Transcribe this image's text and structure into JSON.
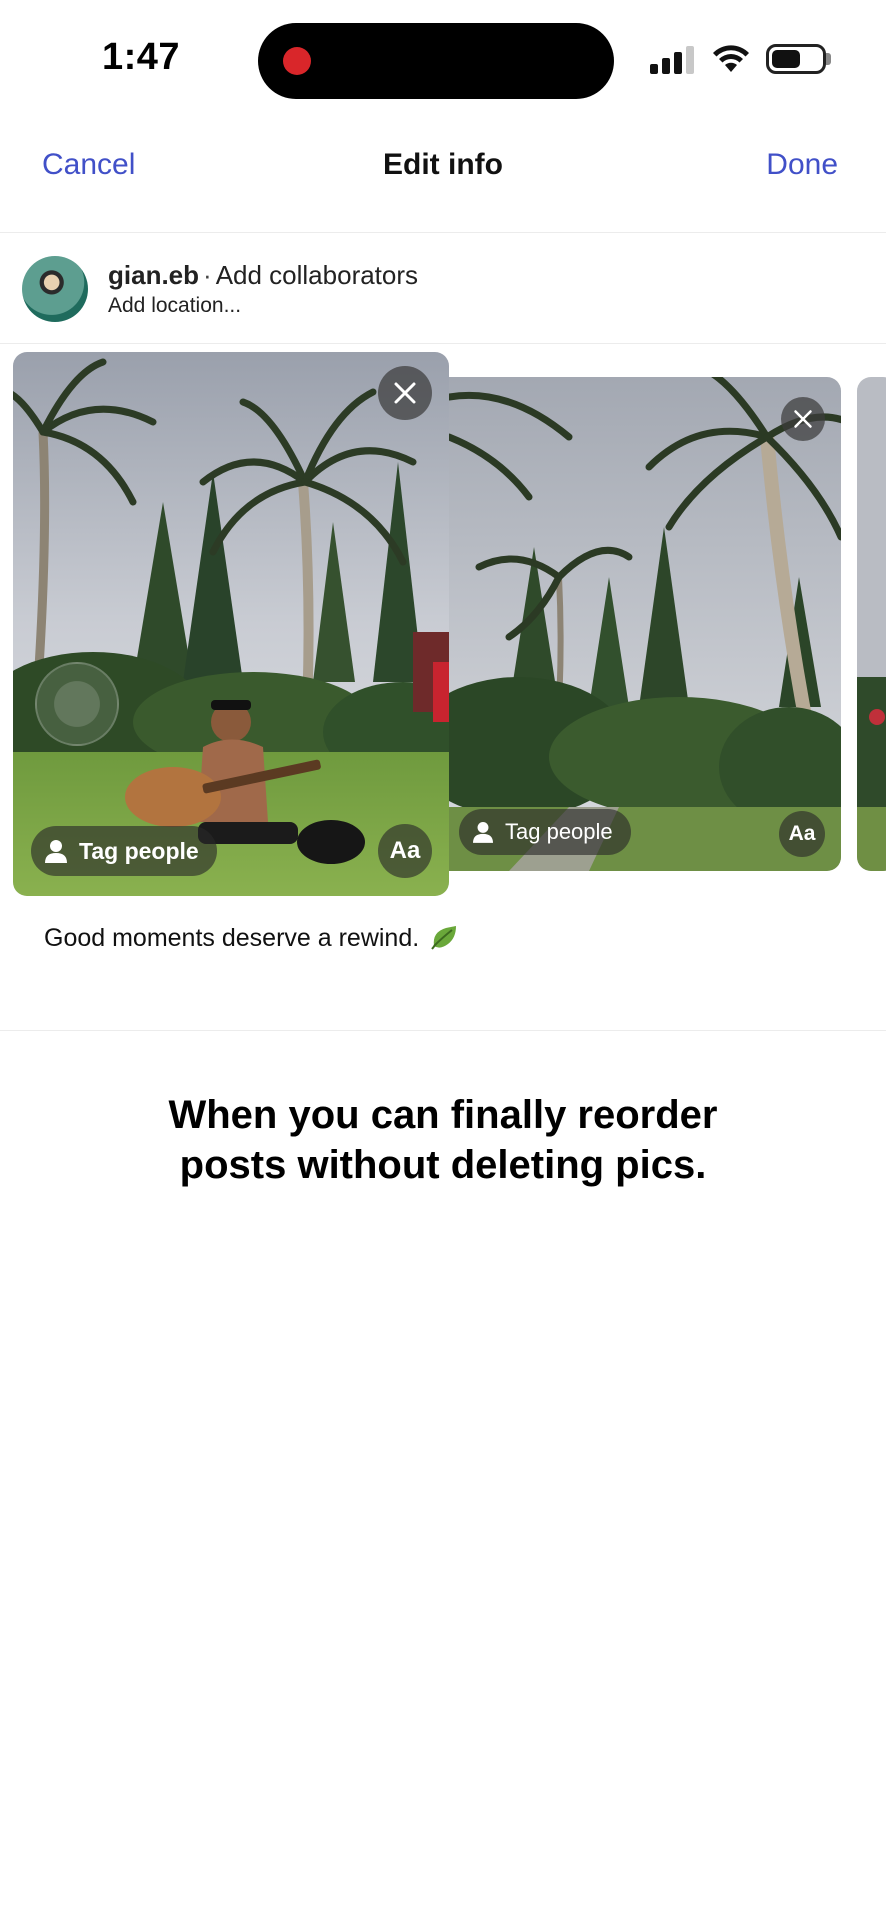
{
  "status_bar": {
    "time": "1:47",
    "recording_indicator_color": "#d9262a",
    "signal_bars_active": 3,
    "signal_bars_total": 4,
    "battery_level": 0.5
  },
  "nav": {
    "cancel_label": "Cancel",
    "title": "Edit info",
    "done_label": "Done",
    "accent_color": "#4150c8"
  },
  "author": {
    "username": "gian.eb",
    "separator": "·",
    "collaborators_label": "Add collaborators",
    "location_placeholder": "Add location..."
  },
  "media": [
    {
      "tag_label": "Tag people",
      "text_label": "Aa",
      "remove_icon": "close-icon"
    },
    {
      "tag_label": "Tag people",
      "text_label": "Aa",
      "remove_icon": "close-icon"
    }
  ],
  "caption": {
    "text": "Good moments deserve a rewind.",
    "emoji": "leaf-emoji"
  },
  "overlay": {
    "line1": "When you can finally reorder",
    "line2": "posts without deleting pics."
  }
}
